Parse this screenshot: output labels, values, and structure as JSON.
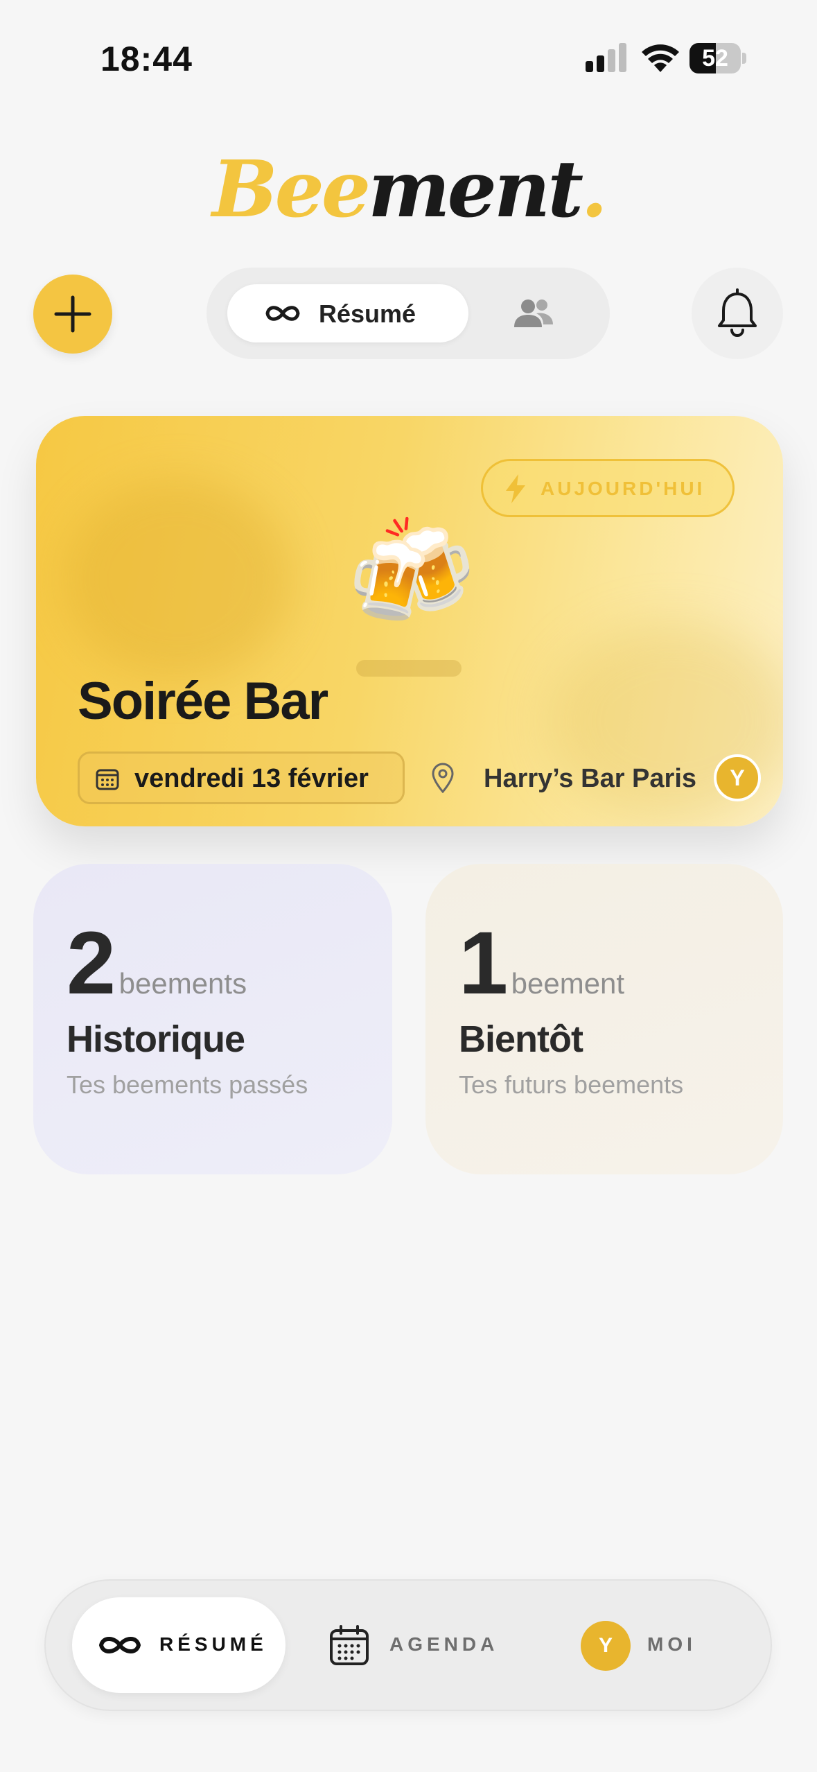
{
  "status_bar": {
    "time": "18:44",
    "battery": "52"
  },
  "logo": {
    "part1": "Bee",
    "part2": "ment",
    "dot": "."
  },
  "top_controls": {
    "segment_active_label": "Résumé",
    "add_icon": "plus-icon",
    "bell_icon": "bell-icon",
    "people_icon": "people-icon"
  },
  "hero": {
    "badge": "AUJOURD'HUI",
    "emoji": "🍻",
    "title": "Soirée Bar",
    "date": "vendredi 13 février",
    "place": "Harry’s Bar Paris",
    "avatar_initial": "Y"
  },
  "stats": [
    {
      "number": "2",
      "unit": "beements",
      "title": "Historique",
      "subtitle": "Tes beements passés"
    },
    {
      "number": "1",
      "unit": "beement",
      "title": "Bientôt",
      "subtitle": "Tes futurs beements"
    }
  ],
  "tabbar": {
    "items": [
      {
        "label": "RÉSUMÉ",
        "icon": "infinity-icon",
        "active": true
      },
      {
        "label": "AGENDA",
        "icon": "calendar-icon",
        "active": false
      },
      {
        "label": "MOI",
        "icon": "avatar",
        "active": false
      }
    ],
    "avatar_initial": "Y"
  },
  "colors": {
    "accent": "#f4c542",
    "text": "#1d1d1d",
    "muted": "#8e8e8e"
  }
}
